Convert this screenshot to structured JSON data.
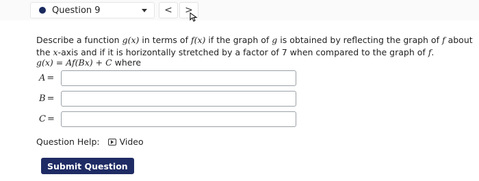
{
  "header": {
    "question_label": "Question 9",
    "prev_label": "<",
    "next_label": ">"
  },
  "question": {
    "text_1": "Describe a function ",
    "g_x": "g(x)",
    "text_2": " in terms of ",
    "f_x": "f(x)",
    "text_3": " if the graph of ",
    "g": "g",
    "text_4": " is obtained by reflecting the graph of ",
    "f": "f",
    "text_5": " about the ",
    "x": "x",
    "text_6": "-axis and if it is horizontally stretched by a factor of 7 when compared to the graph of ",
    "f2": "f",
    "text_7": ".",
    "equation": "g(x) = Af(Bx) + C",
    "where": " where"
  },
  "answers": {
    "A_label": "A",
    "B_label": "B",
    "C_label": "C",
    "equals": "=",
    "A_value": "",
    "B_value": "",
    "C_value": ""
  },
  "help": {
    "label": "Question Help:",
    "video_label": "Video"
  },
  "submit_label": "Submit Question",
  "colors": {
    "accent": "#1f2b64",
    "dot": "#1a2a5e"
  }
}
